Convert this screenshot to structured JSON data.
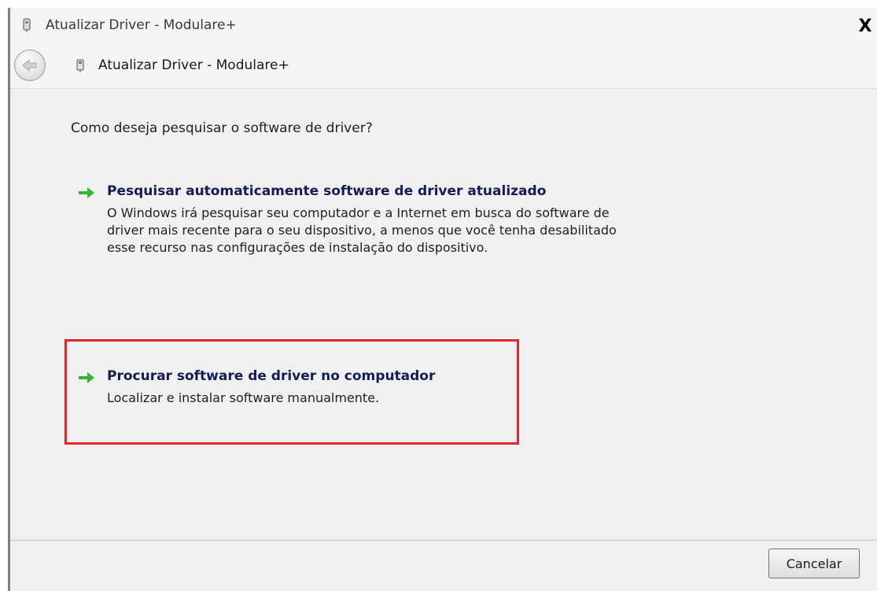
{
  "window": {
    "title": "Atualizar Driver -  Modulare+",
    "close_label": "X"
  },
  "nav": {
    "title": "Atualizar Driver -  Modulare+"
  },
  "content": {
    "question": "Como deseja pesquisar o software de driver?",
    "options": [
      {
        "title": "Pesquisar automaticamente software de driver atualizado",
        "description_lines": [
          "O Windows irá pesquisar seu computador e a Internet em busca do software de",
          "driver mais recente para o seu dispositivo, a menos que você tenha desabilitado",
          "esse recurso nas configurações de instalação do dispositivo."
        ]
      },
      {
        "title": "Procurar software de driver no computador",
        "description_lines": [
          "Localizar e instalar software manualmente."
        ]
      }
    ]
  },
  "footer": {
    "cancel_label": "Cancelar"
  },
  "colors": {
    "option_title": "#151c55",
    "arrow_green": "#2eb82e",
    "highlight_red": "#e3262b"
  },
  "icons": {
    "title": "device-driver-icon",
    "back": "back-arrow-icon",
    "nav": "device-icon",
    "option": "green-arrow-icon"
  }
}
